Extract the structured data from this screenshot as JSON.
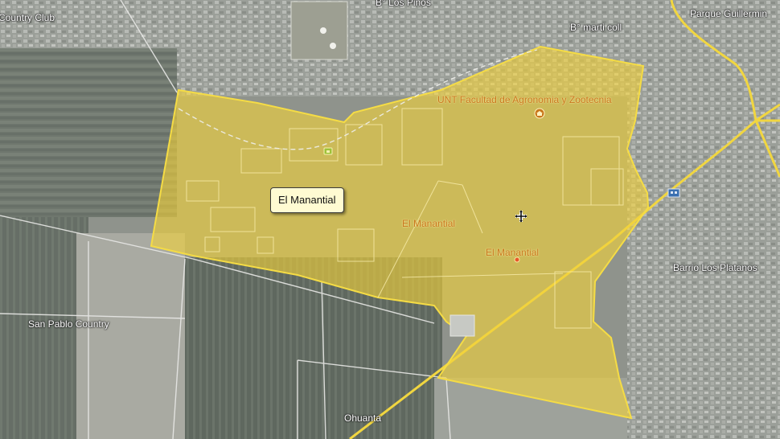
{
  "map": {
    "labels": {
      "country_club": "Country Club",
      "los_pinos": "B° Los Pinos",
      "marti_coll": "B° marti coll",
      "parque_guillermina": "Parque Guillermin",
      "unt": "UNT Facultad de Agronomia y Zootecnia",
      "el_manantial_area": "El Manantial",
      "el_manantial_place": "El Manantial",
      "barrio_platanos": "Barrio Los Platanos",
      "san_pablo": "San Pablo Country",
      "ohuanta": "Ohuanta"
    },
    "tooltip": "El Manantial",
    "colors": {
      "polygon_fill": "#f2d23a",
      "polygon_stroke": "#f5dc45",
      "road_yellow": "#f1d640",
      "label_orange": "#c9771c",
      "satellite_base": "#8f938c"
    },
    "icons": [
      "university-icon",
      "school-icon",
      "place-dot-icon",
      "building-icon",
      "move-cursor-icon"
    ]
  }
}
